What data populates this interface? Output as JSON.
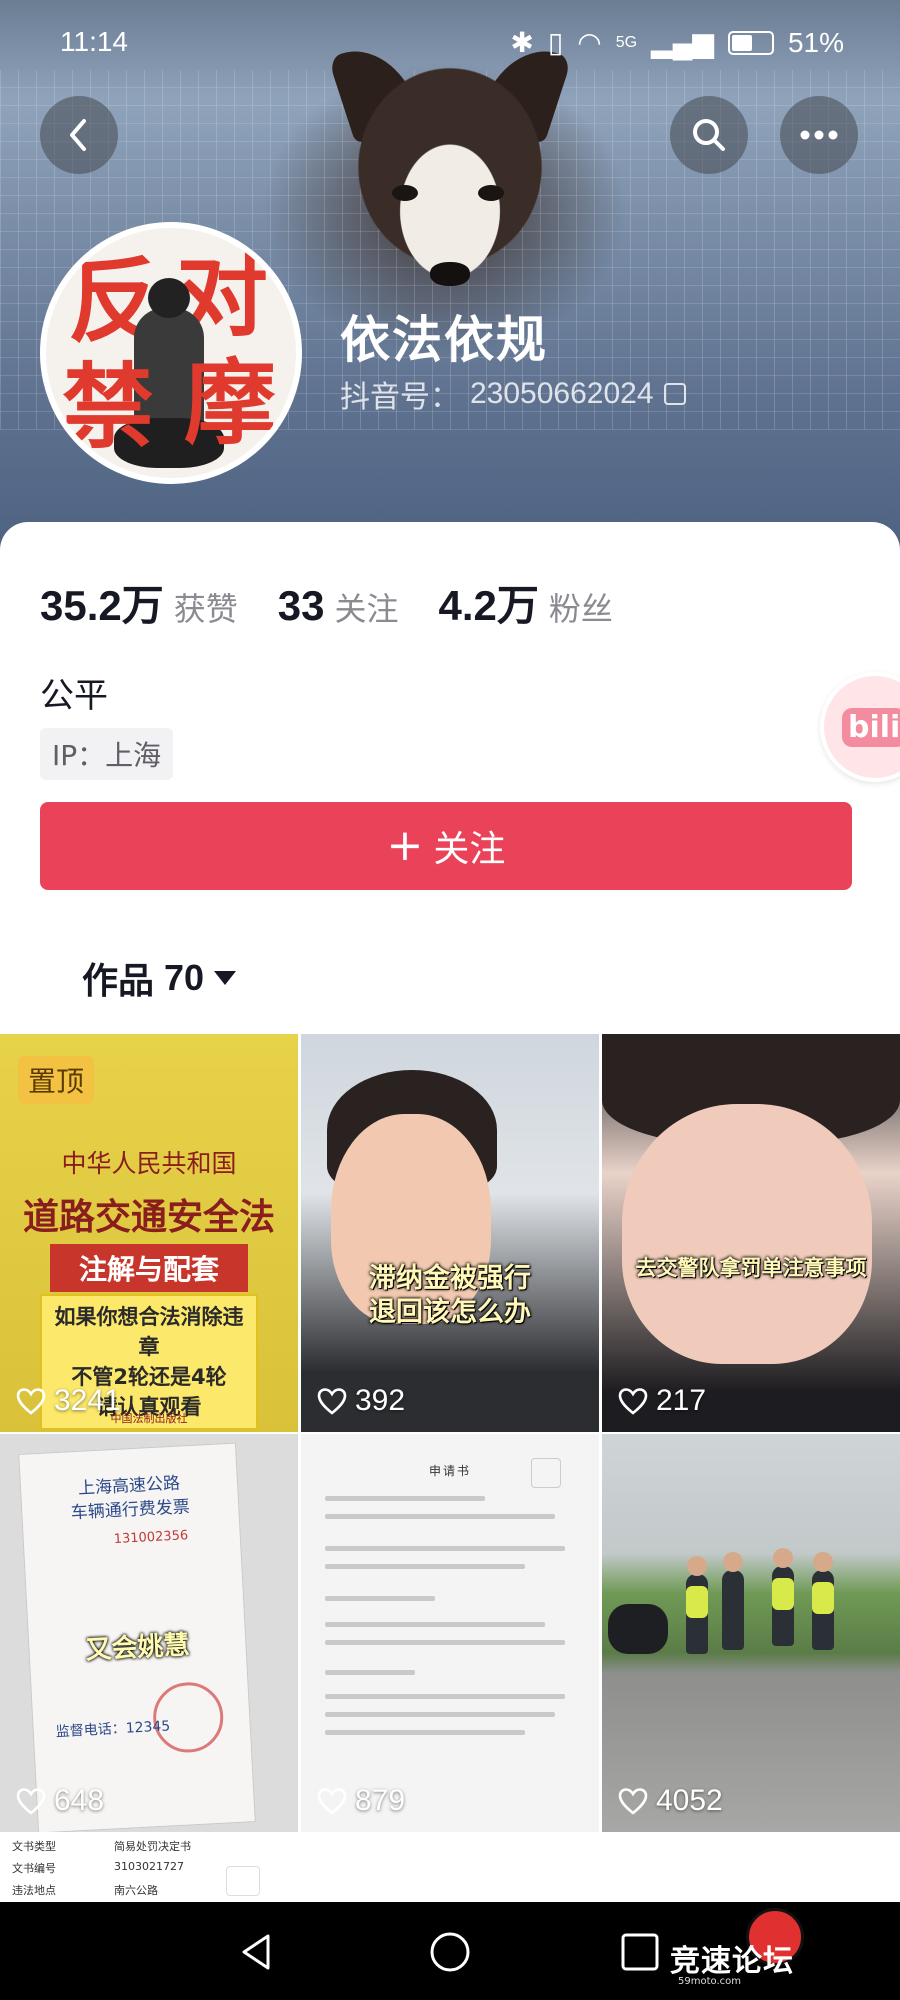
{
  "status_bar": {
    "time": "11:14",
    "network": "5G",
    "battery": "51%"
  },
  "header": {
    "back_icon": "chevron-left-icon",
    "search_icon": "search-icon",
    "more_icon": "more-horizontal-icon"
  },
  "profile": {
    "avatar_text": [
      "反",
      "对",
      "禁",
      "摩"
    ],
    "name": "依法依规",
    "id_label": "抖音号：",
    "id_value": "23050662024",
    "stats": [
      {
        "value": "35.2万",
        "label": "获赞"
      },
      {
        "value": "33",
        "label": "关注"
      },
      {
        "value": "4.2万",
        "label": "粉丝"
      }
    ],
    "bio": "公平",
    "ip": "IP：上海",
    "follow_button": "关注",
    "follow_plus": "+"
  },
  "floating_badge": "bili",
  "works": {
    "label": "作品",
    "count": "70"
  },
  "videos": [
    {
      "likes": "3241",
      "pinned": "置顶",
      "cover_lines": [
        "中华人民共和国",
        "道路交通安全法",
        "注解与配套"
      ],
      "cover_box": [
        "如果你想合法消除违章",
        "不管2轮还是4轮",
        "请认真观看"
      ],
      "publisher": "中国法制出版社"
    },
    {
      "likes": "392",
      "caption": [
        "滞纳金被强行",
        "退回该怎么办"
      ]
    },
    {
      "likes": "217",
      "caption": [
        "去交警队拿罚单注意事项"
      ]
    },
    {
      "likes": "648",
      "ticket_title": "上海高速公路",
      "ticket_sub": "车辆通行费发票",
      "ticket_num": "131002356",
      "caption": "又会姚慧",
      "phone": "监督电话：12345"
    },
    {
      "likes": "879",
      "doc_title": "申请书"
    },
    {
      "likes": "4052"
    }
  ],
  "bottom_doc": {
    "rows": [
      {
        "key": "文书类型",
        "value": "简易处罚决定书"
      },
      {
        "key": "文书编号",
        "value": "3103021727"
      },
      {
        "key": "违法地点",
        "value": "南六公路"
      }
    ]
  },
  "nav": {
    "back": "back-triangle-icon",
    "home": "home-circle-icon",
    "recent": "recent-square-icon"
  },
  "watermark": {
    "brand": "竞速论坛",
    "site": "59moto.com"
  },
  "colors": {
    "accent": "#EA4359",
    "text": "#161823",
    "muted": "#8A8B91"
  }
}
